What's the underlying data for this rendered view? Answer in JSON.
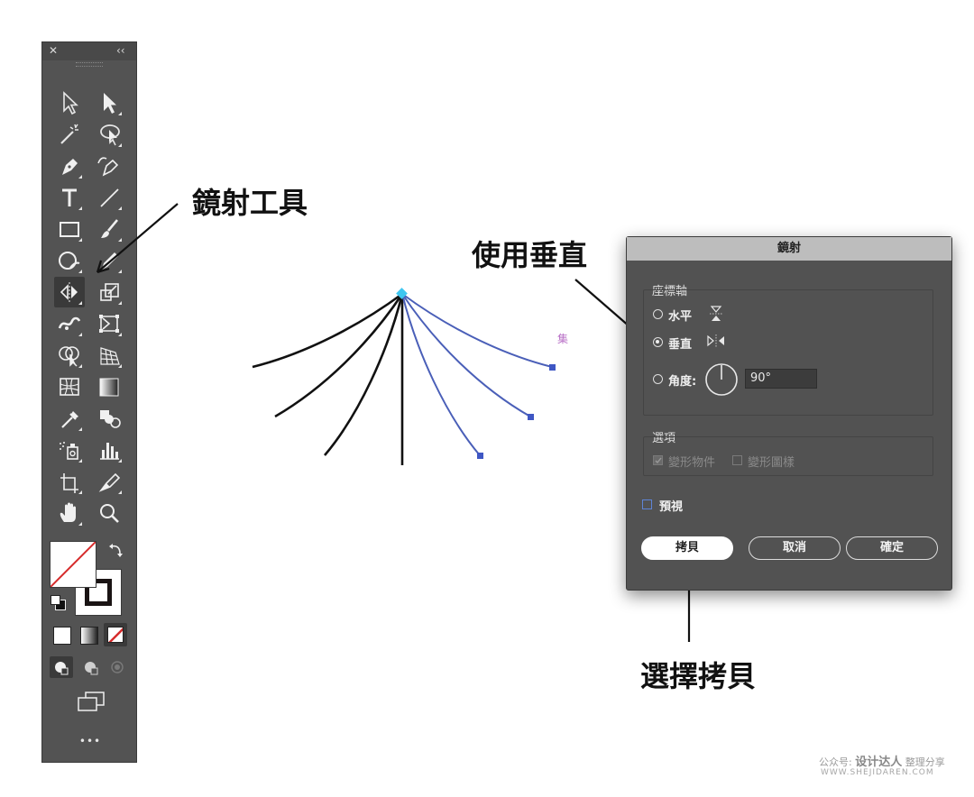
{
  "toolbar": {
    "close_glyph": "✕",
    "collapse_glyph": "‹‹",
    "more_glyph": "•••",
    "tools": [
      "direct-selection-icon",
      "selection-icon",
      "magic-wand-icon",
      "lasso-icon",
      "pen-icon",
      "curvature-icon",
      "type-icon",
      "line-segment-icon",
      "rectangle-icon",
      "paintbrush-icon",
      "shaper-icon",
      "pencil-icon",
      "reflect-icon",
      "scale-icon",
      "width-icon",
      "free-transform-icon",
      "shape-builder-icon",
      "perspective-grid-icon",
      "mesh-icon",
      "gradient-icon",
      "eyedropper-icon",
      "blend-icon",
      "symbol-sprayer-icon",
      "column-graph-icon",
      "artboard-icon",
      "slice-icon",
      "hand-icon",
      "zoom-icon"
    ]
  },
  "annotations": {
    "reflect_tool": "鏡射工具",
    "use_vertical": "使用垂直",
    "choose_copy": "選擇拷貝"
  },
  "canvas": {
    "label": "集"
  },
  "dialog": {
    "title": "鏡射",
    "axis_group": "座標軸",
    "horizontal": "水平",
    "vertical": "垂直",
    "angle_label": "角度:",
    "angle_value": "90°",
    "options_group": "選項",
    "transform_objects": "變形物件",
    "transform_patterns": "變形圖樣",
    "preview": "預視",
    "copy_button": "拷貝",
    "cancel_button": "取消",
    "ok_button": "確定",
    "selected_axis": "vertical"
  },
  "watermark": {
    "line1_prefix": "公众号:",
    "line1_brand": "设计达人",
    "line1_suffix": "整理分享",
    "line2": "WWW.SHEJIDAREN.COM"
  },
  "colors": {
    "toolbar_bg": "#535353",
    "dialog_bg": "#525252",
    "selection_blue": "#4a6fd1",
    "anchor_cyan": "#3ec6f0",
    "no_color_red": "#d62b2b"
  }
}
